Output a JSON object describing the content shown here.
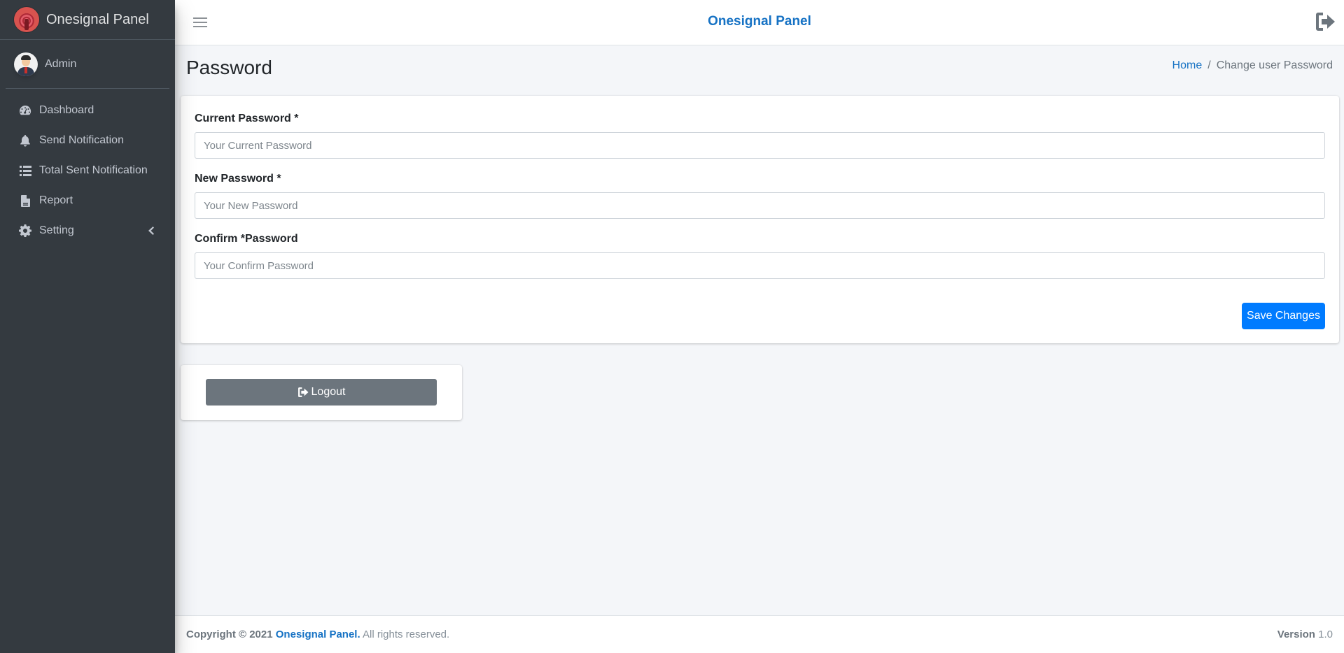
{
  "brand": {
    "name": "Onesignal Panel"
  },
  "user": {
    "name": "Admin"
  },
  "sidebar": {
    "items": [
      {
        "label": "Dashboard",
        "icon": "tachometer-icon"
      },
      {
        "label": "Send Notification",
        "icon": "bell-icon"
      },
      {
        "label": "Total Sent Notification",
        "icon": "list-icon"
      },
      {
        "label": "Report",
        "icon": "file-icon"
      },
      {
        "label": "Setting",
        "icon": "gear-icon"
      }
    ]
  },
  "header": {
    "title": "Onesignal Panel"
  },
  "page": {
    "title": "Password",
    "breadcrumb": {
      "home": "Home",
      "separator": "/",
      "current": "Change user Password"
    }
  },
  "form": {
    "current": {
      "label": "Current Password *",
      "placeholder": "Your Current Password",
      "value": ""
    },
    "new": {
      "label": "New Password *",
      "placeholder": "Your New Password",
      "value": ""
    },
    "confirm": {
      "label": "Confirm *Password",
      "placeholder": "Your Confirm Password",
      "value": ""
    },
    "save_label": "Save Changes"
  },
  "logout": {
    "label": "Logout"
  },
  "footer": {
    "copyright_prefix": "Copyright © 2021",
    "brand_link": "Onesignal Panel.",
    "rights": "All rights reserved.",
    "version_label": "Version",
    "version_value": "1.0"
  },
  "colors": {
    "sidebar_bg": "#343a40",
    "accent": "#1672c4",
    "primary_button": "#007bff",
    "secondary_button": "#6c757d",
    "content_bg": "#f4f6f9"
  }
}
